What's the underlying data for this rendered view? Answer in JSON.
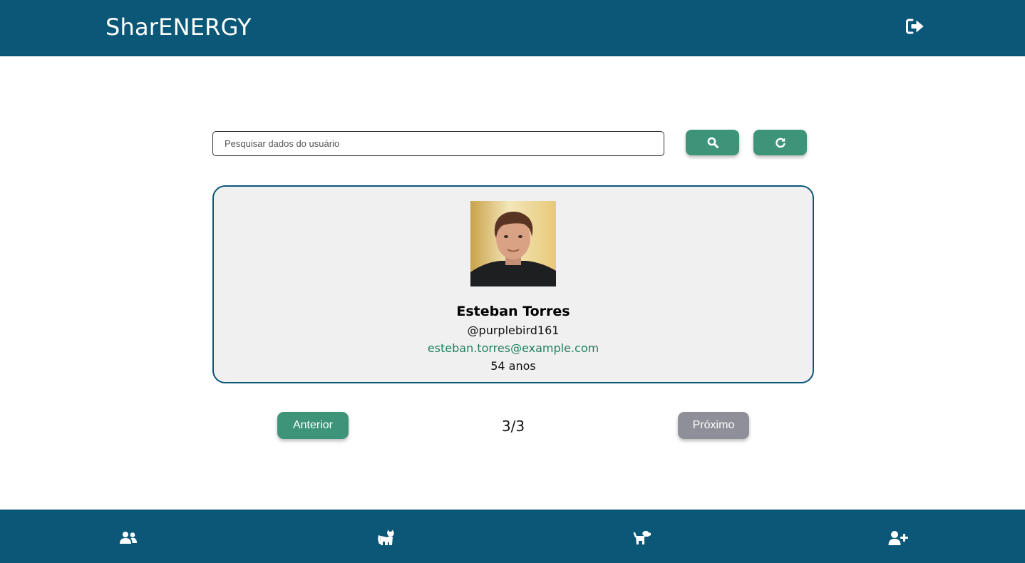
{
  "header": {
    "title": "SharENERGY",
    "logout_icon": "sign-out-icon"
  },
  "search": {
    "placeholder": "Pesquisar dados do usuário",
    "value": "",
    "search_icon": "search-icon",
    "refresh_icon": "refresh-icon"
  },
  "user": {
    "name": "Esteban Torres",
    "username": "@purplebird161",
    "email": "esteban.torres@example.com",
    "age": "54 anos"
  },
  "pagination": {
    "prev_label": "Anterior",
    "next_label": "Próximo",
    "indicator": "3/3"
  },
  "footer_nav": [
    {
      "icon": "users-icon",
      "label": "users"
    },
    {
      "icon": "cat-icon",
      "label": "cat"
    },
    {
      "icon": "dog-icon",
      "label": "dog"
    },
    {
      "icon": "user-plus-icon",
      "label": "add-user"
    }
  ],
  "colors": {
    "primary": "#0b5777",
    "accent_green": "#3d9478",
    "disabled_gray": "#8f8f99",
    "email_green": "#1f7f61",
    "card_bg": "#f0f0f0"
  }
}
